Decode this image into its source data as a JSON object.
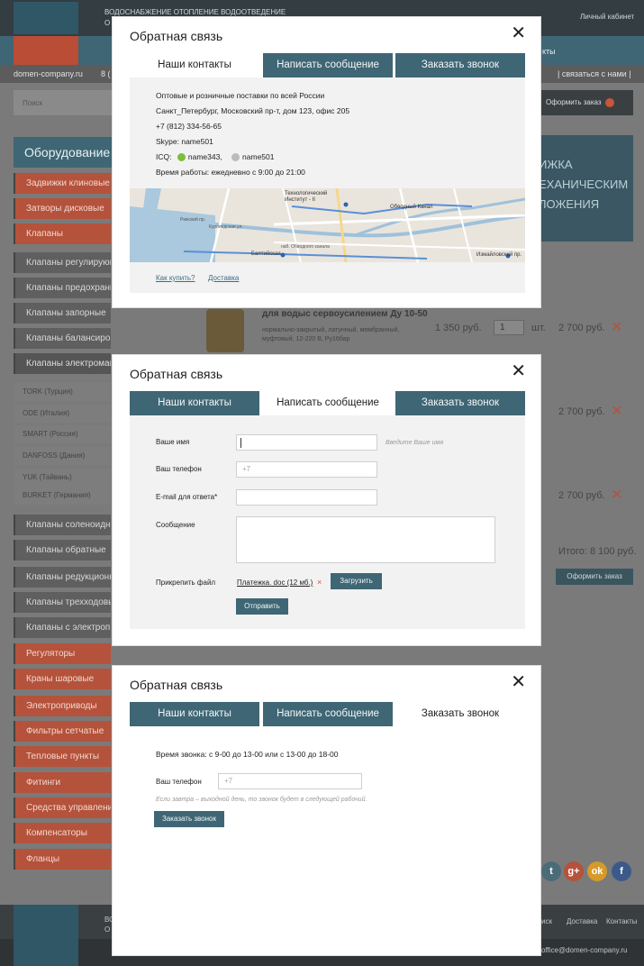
{
  "background": {
    "top_menu": "ВОДОСНАБЖЕНИЕ  ОТОПЛЕНИЕ  ВОДООТВЕДЕНИЕ",
    "top_sub": "О",
    "top_center": "",
    "cabinet": "Личный кабинет",
    "nav_right": "кты",
    "domain": "domen-company.ru",
    "phone_prefix": "8 (",
    "contact_us": "| связаться с нами |",
    "search_placeholder": "Поиск",
    "order_button": "Оформить заказ",
    "order_count": "",
    "sidebar_title": "Оборудование",
    "sidebar_items": [
      "Задвижки клиновые",
      "Затворы дисковые",
      "Клапаны",
      "Клапаны регулирующие",
      "Клапаны предохранительные",
      "Клапаны запорные",
      "Клапаны балансировочные",
      "Клапаны электромагнитные"
    ],
    "brands": [
      "TORK (Турция)",
      "ODE (Италия)",
      "SMART (Россия)",
      "DANFOSS (Дания)",
      "YUK (Тайвань)",
      "BURKET (Германия)"
    ],
    "sidebar_items2": [
      "Клапаны соленоидные",
      "Клапаны обратные",
      "Клапаны редукционные",
      "Клапаны трехходовые",
      "Клапаны с электроприводом"
    ],
    "sidebar_items3": [
      "Регуляторы",
      "Краны шаровые",
      "Электроприводы",
      "Фильтры сетчатые",
      "Тепловые пункты",
      "Фитинги",
      "Средства управления",
      "Компенсаторы",
      "Фланцы"
    ],
    "banner": "ИЖКА ЕХАНИЧЕСКИМ ЛОЖЕНИЯ",
    "product_title": "для водыс сервоусилением Ду 10-50",
    "product_desc": "нормально-закрытый, латунный, мембранный, муфтовый, 12-220 В, Ру16бар",
    "product_price": "1 350 руб.",
    "product_qty": "1",
    "product_unit": "шт.",
    "row_prices": [
      "2 700 руб.",
      "2 700 руб.",
      "2 700 руб."
    ],
    "total": "Итого:  8 100 руб.",
    "order_button2": "Оформить заказ",
    "footer_links": [
      "иск",
      "Доставка",
      "Контакты"
    ],
    "footer_email": "office@domen-company.ru",
    "footer_top": "ВО",
    "footer_sub": "О"
  },
  "modal": {
    "title": "Обратная связь",
    "tabs": [
      "Наши контакты",
      "Написать сообщение",
      "Заказать звонок"
    ]
  },
  "contacts": {
    "line1": "Оптовые и розничные поставки по всей России",
    "line2": "Санкт_Петербург, Московский пр-т,  дом 123, офис 205",
    "line3": "+7 (812) 334-56-65",
    "line4": "Skype: name501",
    "icq_label": "ICQ:",
    "icq1": "name343,",
    "icq2": "name501",
    "line6": "Время работы:  ежедневно с 9:00 до 21:00",
    "link_buy": "Как купить?",
    "link_delivery": "Доставка",
    "map_labels": [
      "Технологический Институт - II",
      "Обводный Канал",
      "Балтийская",
      "Нарвская",
      "Курляндская ул.",
      "Рижский пр.",
      "наб. Обводного канала",
      "Московский пр.",
      "Лермонтовский пр.",
      "Лиговский пр.",
      "Рыбинская ул.",
      "Новолочная",
      "Измайловский пр."
    ]
  },
  "message": {
    "name_label": "Ваше имя",
    "name_value": "",
    "name_hint": "Введите Ваше имя",
    "phone_label": "Ваш телефон",
    "phone_placeholder": "+7",
    "email_label": "E-mail для ответа*",
    "email_value": "",
    "text_label": "Сообщение",
    "text_value": "",
    "file_label": "Прикрепить файл",
    "file_name": "Платежка. doc (12 мб.)",
    "file_remove": "×",
    "upload_button": "Загрузить",
    "send_button": "Отправить"
  },
  "callback": {
    "time_text": "Время звонка: с 9-00 до 13-00 или с 13-00 до 18-00",
    "phone_label": "Ваш телефон",
    "phone_placeholder": "+7",
    "note": "Если завтра – выходной день, то звонок будет в следующей рабочий.",
    "submit_button": "Заказать звонок"
  },
  "colors": {
    "accent": "#3f6675",
    "red": "#b5523b",
    "panel": "#f2f2f2"
  }
}
